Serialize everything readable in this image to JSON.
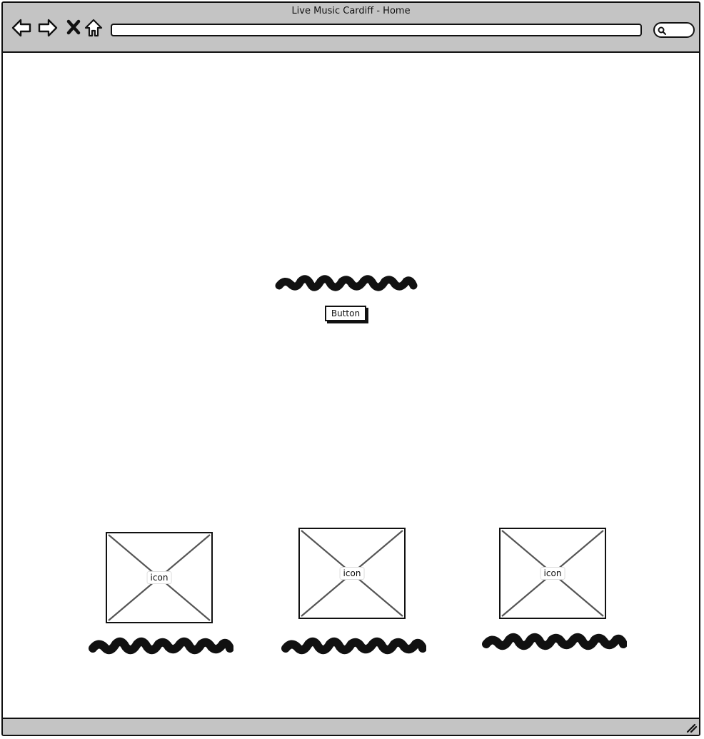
{
  "window": {
    "title": "Live Music Cardiff - Home"
  },
  "toolbar": {
    "back_icon": "back-arrow-icon",
    "forward_icon": "forward-arrow-icon",
    "stop_icon": "close-icon",
    "home_icon": "home-icon",
    "address_value": "",
    "search_icon": "search-icon"
  },
  "hero": {
    "button_label": "Button"
  },
  "cards": [
    {
      "icon_label": "icon"
    },
    {
      "icon_label": "icon"
    },
    {
      "icon_label": "icon"
    }
  ],
  "colors": {
    "chrome": "#c4c4c4",
    "ink": "#111111",
    "placeholder_line": "#555555"
  }
}
